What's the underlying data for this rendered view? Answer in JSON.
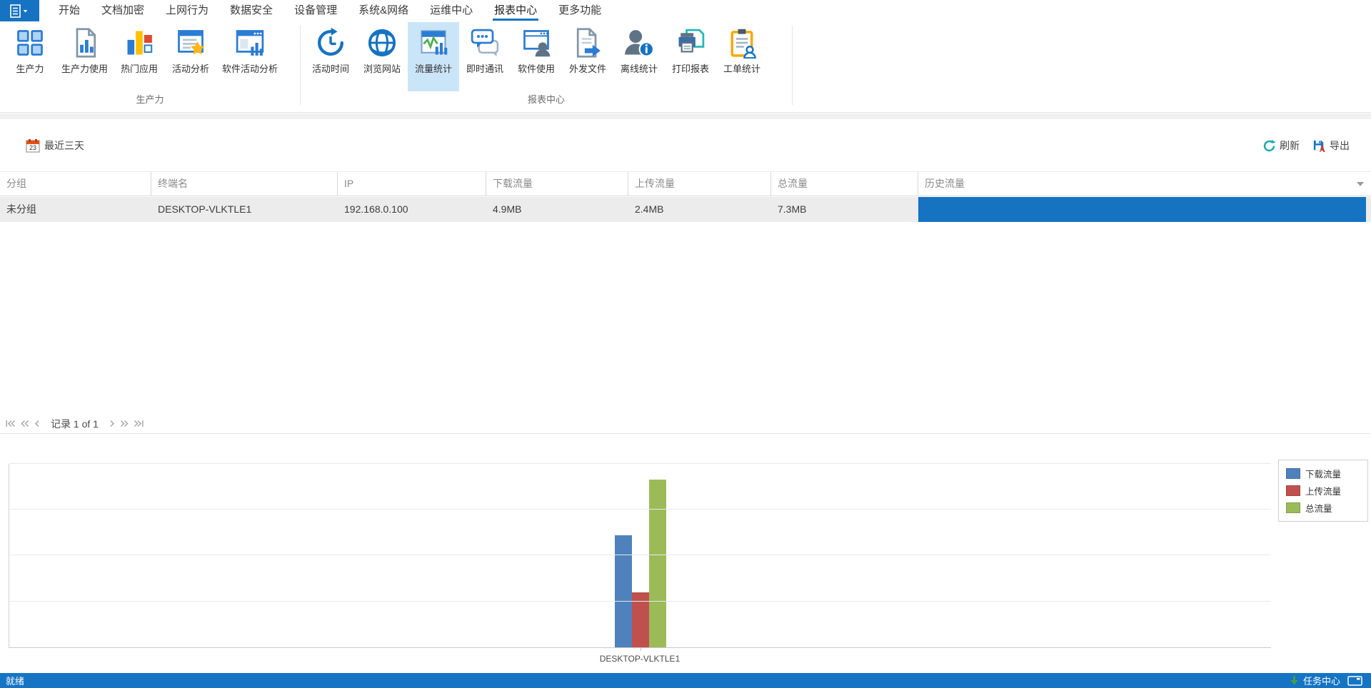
{
  "colors": {
    "accent": "#1673c1",
    "ribbon_selected_bg": "#cbe5f8",
    "selected_row_bg": "#ececec",
    "history_bar": "#1673c1",
    "statusbar_bg": "#1574c4"
  },
  "menubar": {
    "tabs": [
      {
        "label": "开始"
      },
      {
        "label": "文档加密"
      },
      {
        "label": "上网行为"
      },
      {
        "label": "数据安全"
      },
      {
        "label": "设备管理"
      },
      {
        "label": "系统&网络"
      },
      {
        "label": "运维中心"
      },
      {
        "label": "报表中心",
        "active": true
      },
      {
        "label": "更多功能"
      }
    ]
  },
  "ribbon": {
    "groups": [
      {
        "label": "生产力",
        "items": [
          {
            "label": "生产力",
            "icon": "grid-icon"
          },
          {
            "label": "生产力使用",
            "icon": "doc-bars-icon"
          },
          {
            "label": "热门应用",
            "icon": "hot-apps-icon"
          },
          {
            "label": "活动分析",
            "icon": "doc-star-icon"
          },
          {
            "label": "软件活动分析",
            "icon": "window-bars-icon"
          }
        ]
      },
      {
        "label": "报表中心",
        "items": [
          {
            "label": "活动时间",
            "icon": "clock-history-icon"
          },
          {
            "label": "浏览网站",
            "icon": "globe-icon"
          },
          {
            "label": "流量统计",
            "icon": "traffic-stats-icon",
            "selected": true
          },
          {
            "label": "即时通讯",
            "icon": "chat-icon"
          },
          {
            "label": "软件使用",
            "icon": "window-user-icon"
          },
          {
            "label": "外发文件",
            "icon": "doc-arrow-icon"
          },
          {
            "label": "离线统计",
            "icon": "user-info-icon"
          },
          {
            "label": "打印报表",
            "icon": "printer-icon"
          },
          {
            "label": "工单统计",
            "icon": "clipboard-user-icon"
          }
        ]
      }
    ]
  },
  "toolbar": {
    "date_filter_label": "最近三天",
    "calendar_day": "23",
    "refresh_label": "刷新",
    "export_label": "导出"
  },
  "table": {
    "columns": [
      "分组",
      "终端名",
      "IP",
      "下载流量",
      "上传流量",
      "总流量",
      "历史流量"
    ],
    "rows": [
      {
        "group": "未分组",
        "terminal": "DESKTOP-VLKTLE1",
        "ip": "192.168.0.100",
        "download": "4.9MB",
        "upload": "2.4MB",
        "total": "7.3MB"
      }
    ]
  },
  "pagination": {
    "record_text": "记录 1 of 1"
  },
  "chart_data": {
    "type": "bar",
    "title": "",
    "xlabel": "",
    "ylabel": "",
    "categories": [
      "DESKTOP-VLKTLE1"
    ],
    "series": [
      {
        "name": "下载流量",
        "values": [
          4.9
        ],
        "color": "#4f81bd"
      },
      {
        "name": "上传流量",
        "values": [
          2.4
        ],
        "color": "#c0504d"
      },
      {
        "name": "总流量",
        "values": [
          7.3
        ],
        "color": "#9bbb59"
      }
    ],
    "unit": "MB",
    "ylim": [
      0,
      8
    ],
    "grid_step": 2,
    "grid": true,
    "legend_position": "top-right"
  },
  "statusbar": {
    "ready_text": "就绪",
    "task_center_label": "任务中心"
  }
}
